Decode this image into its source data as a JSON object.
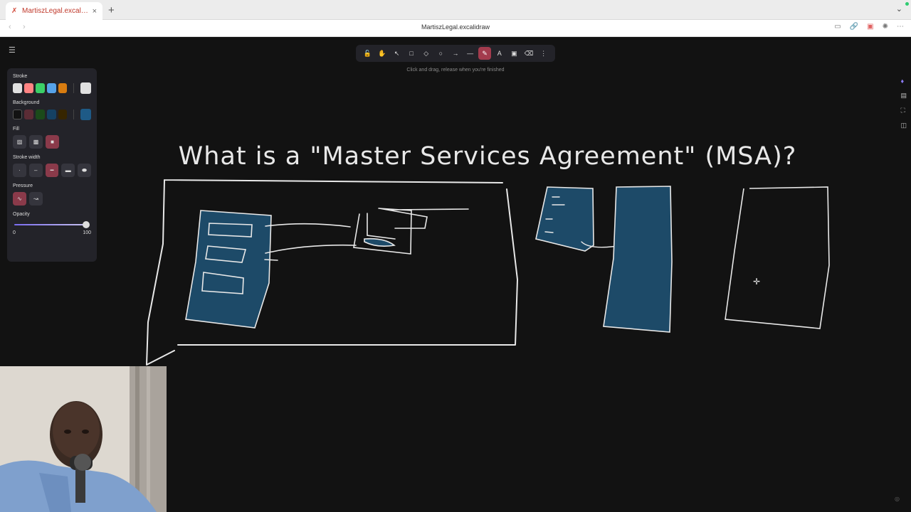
{
  "browser": {
    "tab_title": "MartiszLegal.excalid...",
    "tab_close": "×",
    "new_tab": "+",
    "tab_list_icon": "chevron-down-icon",
    "window_title": "MartiszLegal.excalidraw",
    "back": "‹",
    "forward": "›"
  },
  "toolbar": {
    "tools": [
      {
        "name": "lock-icon",
        "glyph": "🔓"
      },
      {
        "name": "hand-icon",
        "glyph": "✋"
      },
      {
        "name": "selection-icon",
        "glyph": "↖"
      },
      {
        "name": "rectangle-icon",
        "glyph": "□"
      },
      {
        "name": "diamond-icon",
        "glyph": "◇"
      },
      {
        "name": "ellipse-icon",
        "glyph": "○"
      },
      {
        "name": "arrow-icon",
        "glyph": "→"
      },
      {
        "name": "line-icon",
        "glyph": "—"
      },
      {
        "name": "draw-icon",
        "glyph": "✎"
      },
      {
        "name": "text-icon",
        "glyph": "A"
      },
      {
        "name": "image-icon",
        "glyph": "▣"
      },
      {
        "name": "eraser-icon",
        "glyph": "⌫"
      },
      {
        "name": "more-tools-icon",
        "glyph": "⋮"
      }
    ],
    "active_tool": "draw-icon",
    "hint": "Click and drag, release when you're finished"
  },
  "properties": {
    "stroke_label": "Stroke",
    "stroke_colors": [
      "#e0e0e0",
      "#ff8383",
      "#3bcf67",
      "#56a2e8",
      "#d87c10"
    ],
    "stroke_current": "#e0e0e0",
    "background_label": "Background",
    "background_colors": [
      "#121212",
      "#5b2c35",
      "#1b4a1a",
      "#154163",
      "#362500"
    ],
    "background_current": "#1e5a86",
    "fill_label": "Fill",
    "stroke_width_label": "Stroke width",
    "pressure_label": "Pressure",
    "opacity_label": "Opacity",
    "opacity_min": "0",
    "opacity_max": "100",
    "opacity_value": 100
  },
  "canvas": {
    "title": "What is a \"Master Services Agreement\" (MSA)?",
    "stroke_color": "#e8e8e8",
    "fill_color": "#1d4a68"
  }
}
